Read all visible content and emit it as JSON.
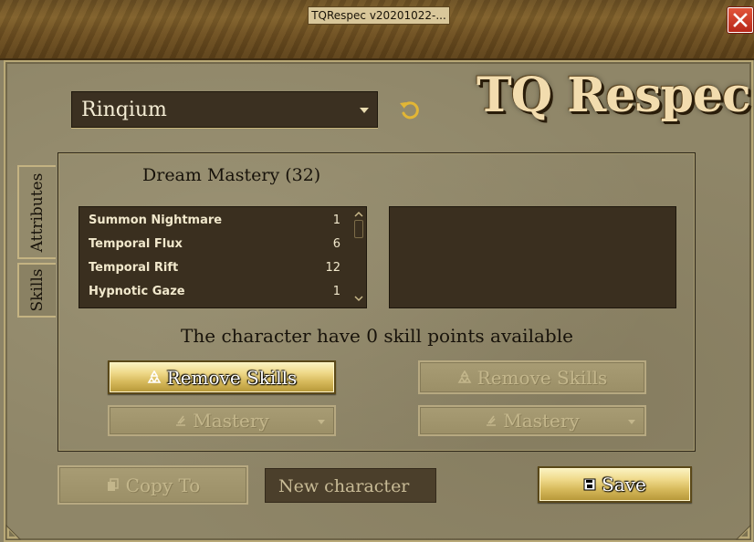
{
  "window": {
    "title": "TQRespec v20201022-..."
  },
  "character": {
    "selected": "Rinqium"
  },
  "logo": {
    "text": "TQ Respec"
  },
  "tabs": [
    {
      "label": "Attributes"
    },
    {
      "label": "Skills"
    }
  ],
  "mastery": {
    "title": "Dream Mastery (32)"
  },
  "skills": [
    {
      "name": "Summon Nightmare",
      "value": "1"
    },
    {
      "name": "Temporal Flux",
      "value": "6"
    },
    {
      "name": "Temporal Rift",
      "value": "12"
    },
    {
      "name": "Hypnotic Gaze",
      "value": "1"
    }
  ],
  "status": {
    "points_text": "The character have 0 skill points available"
  },
  "buttons": {
    "remove_skills_left": "Remove Skills",
    "remove_skills_right": "Remove Skills",
    "mastery_left": "Mastery",
    "mastery_right": "Mastery",
    "copy_to": "Copy To",
    "save": "Save"
  },
  "new_character": {
    "placeholder": "New character"
  }
}
